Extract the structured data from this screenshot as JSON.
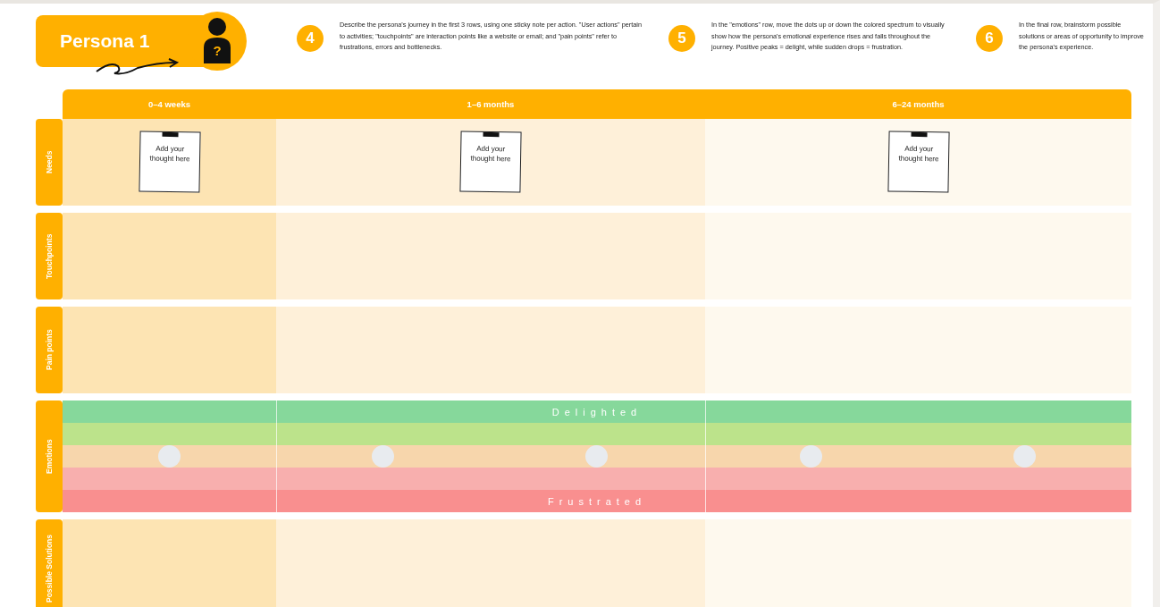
{
  "persona": {
    "title": "Persona 1",
    "icon_glyph": "?"
  },
  "instructions": [
    {
      "number": "4",
      "text": "Describe the persona's journey in the first 3 rows, using one sticky note per action. \"User actions\" pertain to activities; \"touchpoints\" are interaction points like a website or email; and \"pain points\" refer to frustrations, errors and bottlenecks."
    },
    {
      "number": "5",
      "text": "In the \"emotions\" row, move the dots up or down the colored spectrum to visually show how the persona's emotional experience rises and falls throughout the journey. Positive peaks = delight, while sudden drops = frustration."
    },
    {
      "number": "6",
      "text": "In the final row, brainstorm possible solutions or areas of opportunity to improve the persona's experience."
    }
  ],
  "stages": [
    {
      "label": "0–4 weeks"
    },
    {
      "label": "1–6 months"
    },
    {
      "label": "6–24 months"
    }
  ],
  "rows": [
    {
      "kind": "notes",
      "label": "Needs",
      "cells": [
        {
          "notes": [
            "Add your thought here"
          ]
        },
        {
          "notes": [
            "Add your thought here"
          ]
        },
        {
          "notes": [
            "Add your thought here"
          ]
        }
      ]
    },
    {
      "kind": "notes",
      "label": "Touchpoints"
    },
    {
      "kind": "notes",
      "label": "Pain points"
    },
    {
      "kind": "emotions",
      "label": "Emotions",
      "bands": [
        {
          "color": "#86d89b",
          "label": "Delighted",
          "has_dots": false
        },
        {
          "color": "#bce38b",
          "has_dots": false
        },
        {
          "color": "#f7d6ac",
          "has_dots": true
        },
        {
          "color": "#f8afae",
          "has_dots": false
        },
        {
          "color": "#f98f8f",
          "label": "Frustrated",
          "has_dots": false
        }
      ]
    },
    {
      "kind": "notes",
      "label": "Possible Solutions"
    }
  ]
}
